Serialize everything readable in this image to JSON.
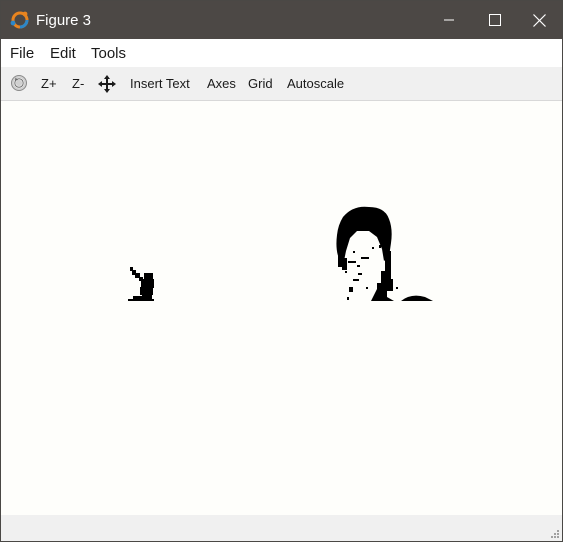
{
  "window": {
    "title": "Figure 3",
    "titlebar_color": "#4c4845",
    "icons": {
      "app": "octave-logo-icon",
      "minimize": "minimize-icon",
      "maximize": "maximize-icon",
      "close": "close-icon"
    }
  },
  "menubar": {
    "items": [
      {
        "label": "File"
      },
      {
        "label": "Edit"
      },
      {
        "label": "Tools"
      }
    ]
  },
  "toolbar": {
    "rotate_icon": "rotate-icon",
    "zoom_in": "Z+",
    "zoom_out": "Z-",
    "pan_icon": "pan-arrows-icon",
    "insert_text": "Insert Text",
    "axes": "Axes",
    "grid": "Grid",
    "autoscale": "Autoscale"
  },
  "figure": {
    "content": "thresholded black-and-white image",
    "background": "#fefefb"
  },
  "statusbar": {
    "grip_icon": "resize-grip-icon"
  }
}
